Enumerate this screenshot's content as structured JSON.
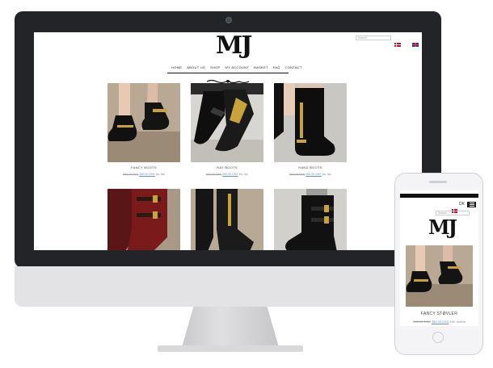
{
  "desktop": {
    "logo": "MJ",
    "search": {
      "placeholder": "Search"
    },
    "flags": [
      "dk",
      "gb"
    ],
    "nav": [
      "HOME",
      "ABOUT US",
      "SHOP",
      "MY ACCOUNT",
      "BASKET",
      "FAQ",
      "CONTACT"
    ],
    "products": [
      {
        "title": "FANCY BOOTS",
        "old_price": "590,00 DKK",
        "new_price": "350,00 DKK",
        "tax": "inc. tax"
      },
      {
        "title": "RAY BOOTS",
        "old_price": "500,00 DKK",
        "new_price": "350,00 DKK",
        "tax": "inc. tax"
      },
      {
        "title": "HAND BOOTS",
        "old_price": "640,00 DKK",
        "new_price": "400,00 DKK",
        "tax": "inc. tax"
      }
    ]
  },
  "phone": {
    "logo": "MJ",
    "lang": "DK",
    "search": {
      "placeholder": "Search"
    },
    "product": {
      "title": "FANCY STØVLER",
      "old_price": "590,00 DKK",
      "new_price": "350,00 DKK",
      "tax": "inkl. moms"
    }
  },
  "colors": {
    "bezel": "#232428",
    "chin": "#e3e3e5",
    "price_link": "#6a8fcf"
  }
}
